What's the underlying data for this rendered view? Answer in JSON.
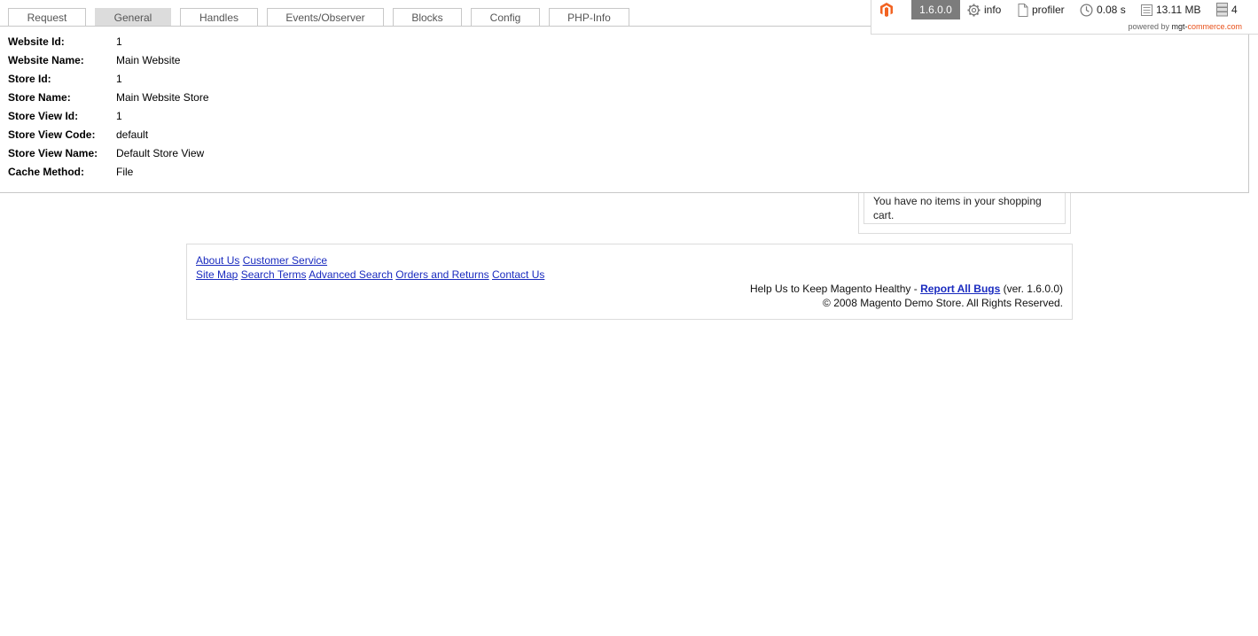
{
  "tabs": [
    {
      "label": "Request",
      "active": false
    },
    {
      "label": "General",
      "active": true
    },
    {
      "label": "Handles",
      "active": false
    },
    {
      "label": "Events/Observer",
      "active": false
    },
    {
      "label": "Blocks",
      "active": false
    },
    {
      "label": "Config",
      "active": false
    },
    {
      "label": "PHP-Info",
      "active": false
    }
  ],
  "general": [
    {
      "label": "Website Id:",
      "value": "1"
    },
    {
      "label": "Website Name:",
      "value": "Main Website"
    },
    {
      "label": "Store Id:",
      "value": "1"
    },
    {
      "label": "Store Name:",
      "value": "Main Website Store"
    },
    {
      "label": "Store View Id:",
      "value": "1"
    },
    {
      "label": "Store View Code:",
      "value": "default"
    },
    {
      "label": "Store View Name:",
      "value": "Default Store View"
    },
    {
      "label": "Cache Method:",
      "value": "File"
    }
  ],
  "toolbar": {
    "version": "1.6.0.0",
    "info_label": "info",
    "profiler_label": "profiler",
    "time": "0.08 s",
    "memory": "13.11 MB",
    "queries": "4",
    "powered_prefix": "powered by",
    "powered_brand1": "mgt-",
    "powered_brand2": "commerce.com",
    "icons": {
      "logo": "magento-logo-icon",
      "info": "gear-icon",
      "profiler": "document-icon",
      "time": "clock-icon",
      "memory": "memory-icon",
      "queries": "database-icon"
    },
    "colors": {
      "version_bg": "#7c7c7c",
      "logo": "#f26322",
      "brand_accent": "#e8501a"
    }
  },
  "cart": {
    "message": "You have no items in your shopping cart."
  },
  "footer": {
    "links_row1": [
      "About Us",
      "Customer Service"
    ],
    "links_row2": [
      "Site Map",
      "Search Terms",
      "Advanced Search",
      "Orders and Returns",
      "Contact Us"
    ],
    "help_text": "Help Us to Keep Magento Healthy - ",
    "report_link": "Report All Bugs",
    "version_text": " (ver. 1.6.0.0)",
    "copyright": "© 2008 Magento Demo Store. All Rights Reserved.",
    "link_color": "#1a2bbf"
  }
}
